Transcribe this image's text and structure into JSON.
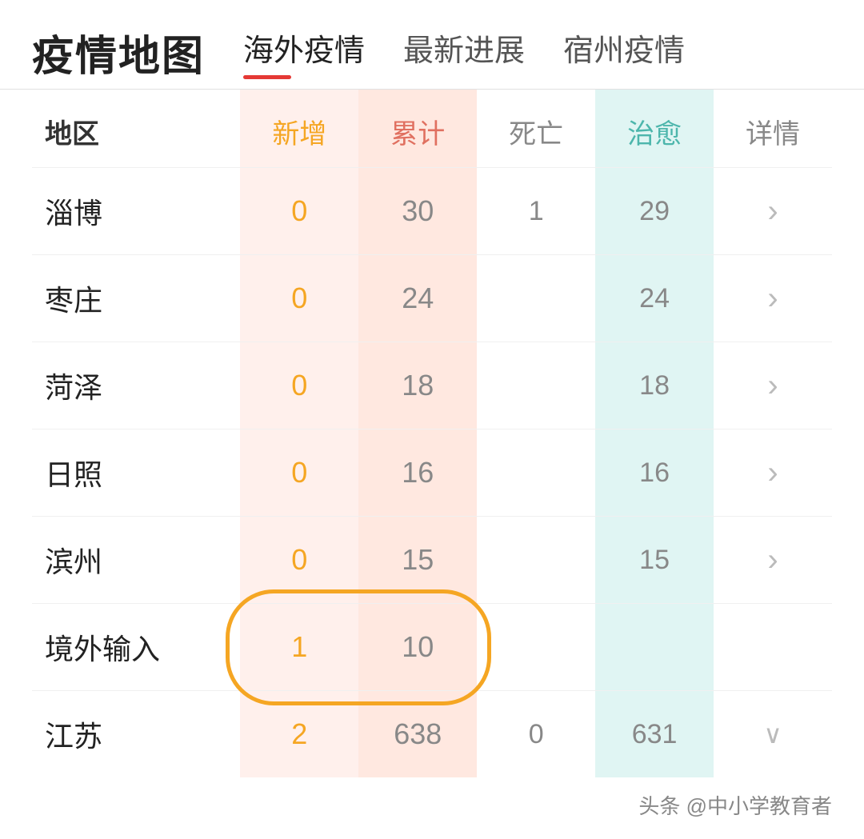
{
  "header": {
    "title": "疫情地图",
    "nav": [
      {
        "label": "海外疫情",
        "active": false
      },
      {
        "label": "最新进展",
        "active": false
      },
      {
        "label": "宿州疫情",
        "active": false
      }
    ],
    "active_nav": "疫情地图"
  },
  "table": {
    "columns": [
      {
        "key": "region",
        "label": "地区",
        "class": ""
      },
      {
        "key": "xinzeng",
        "label": "新增",
        "class": "col-xinzeng"
      },
      {
        "key": "leiji",
        "label": "累计",
        "class": "col-leiji"
      },
      {
        "key": "siwang",
        "label": "死亡",
        "class": "col-siwang"
      },
      {
        "key": "zhiyu",
        "label": "治愈",
        "class": "col-zhiyu"
      },
      {
        "key": "xiangqing",
        "label": "详情",
        "class": "col-xiangqing"
      }
    ],
    "rows": [
      {
        "region": "淄博",
        "xinzeng": "0",
        "leiji": "30",
        "siwang": "1",
        "zhiyu": "29",
        "chevron": "right",
        "highlight": false
      },
      {
        "region": "枣庄",
        "xinzeng": "0",
        "leiji": "24",
        "siwang": "",
        "zhiyu": "24",
        "chevron": "right",
        "highlight": false
      },
      {
        "region": "菏泽",
        "xinzeng": "0",
        "leiji": "18",
        "siwang": "",
        "zhiyu": "18",
        "chevron": "right",
        "highlight": false
      },
      {
        "region": "日照",
        "xinzeng": "0",
        "leiji": "16",
        "siwang": "",
        "zhiyu": "16",
        "chevron": "right",
        "highlight": false
      },
      {
        "region": "滨州",
        "xinzeng": "0",
        "leiji": "15",
        "siwang": "",
        "zhiyu": "15",
        "chevron": "right",
        "highlight": false
      },
      {
        "region": "境外输入",
        "xinzeng": "1",
        "leiji": "10",
        "siwang": "",
        "zhiyu": "",
        "chevron": "none",
        "highlight": true
      },
      {
        "region": "江苏",
        "xinzeng": "2",
        "leiji": "638",
        "siwang": "0",
        "zhiyu": "631",
        "chevron": "down",
        "highlight": false
      }
    ]
  },
  "footer": {
    "text": "头条 @中小学教育者"
  }
}
